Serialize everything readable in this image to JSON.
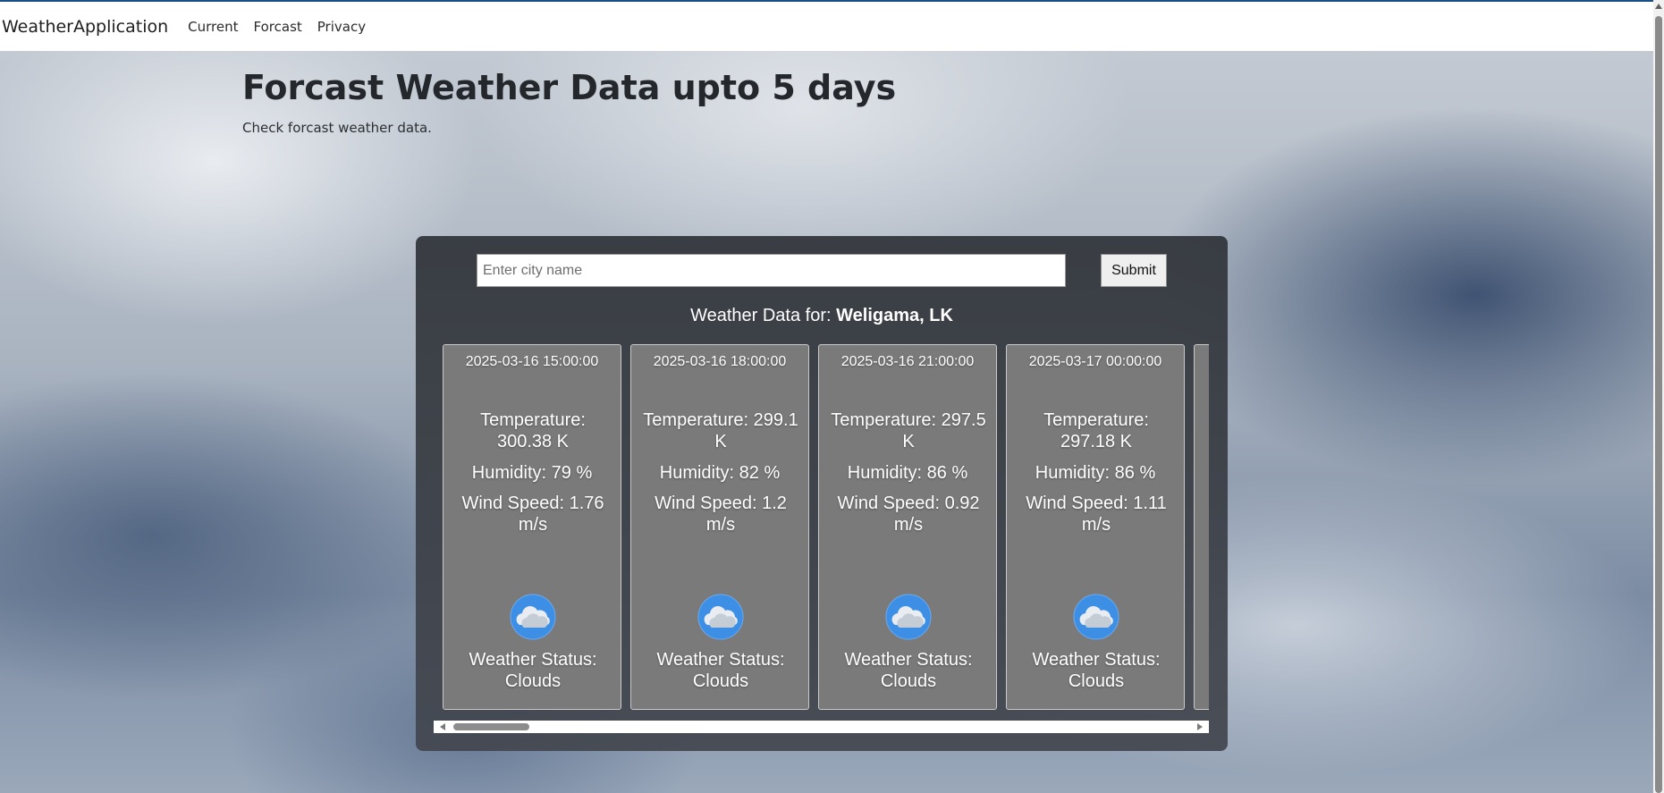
{
  "navbar": {
    "brand": "WeatherApplication",
    "links": [
      "Current",
      "Forcast",
      "Privacy"
    ]
  },
  "page": {
    "title": "Forcast Weather Data upto 5 days",
    "subtitle": "Check forcast weather data."
  },
  "search": {
    "placeholder": "Enter city name",
    "value": "",
    "submit_label": "Submit"
  },
  "location": {
    "prefix": "Weather Data for:",
    "name": "Weligama, LK"
  },
  "forecast": [
    {
      "datetime": "2025-03-16 15:00:00",
      "temperature": "Temperature: 300.38 K",
      "humidity": "Humidity: 79 %",
      "wind": "Wind Speed: 1.76 m/s",
      "icon": "clouds-icon",
      "status": "Weather Status: Clouds"
    },
    {
      "datetime": "2025-03-16 18:00:00",
      "temperature": "Temperature: 299.1 K",
      "humidity": "Humidity: 82 %",
      "wind": "Wind Speed: 1.2 m/s",
      "icon": "clouds-icon",
      "status": "Weather Status: Clouds"
    },
    {
      "datetime": "2025-03-16 21:00:00",
      "temperature": "Temperature: 297.5 K",
      "humidity": "Humidity: 86 %",
      "wind": "Wind Speed: 0.92 m/s",
      "icon": "clouds-icon",
      "status": "Weather Status: Clouds"
    },
    {
      "datetime": "2025-03-17 00:00:00",
      "temperature": "Temperature: 297.18 K",
      "humidity": "Humidity: 86 %",
      "wind": "Wind Speed: 1.11 m/s",
      "icon": "clouds-icon",
      "status": "Weather Status: Clouds"
    }
  ],
  "colors": {
    "panel": "#34383e",
    "card": "#7a7a7a",
    "nav_border": "#1a4e86",
    "icon_circle": "#3d8fe6"
  }
}
